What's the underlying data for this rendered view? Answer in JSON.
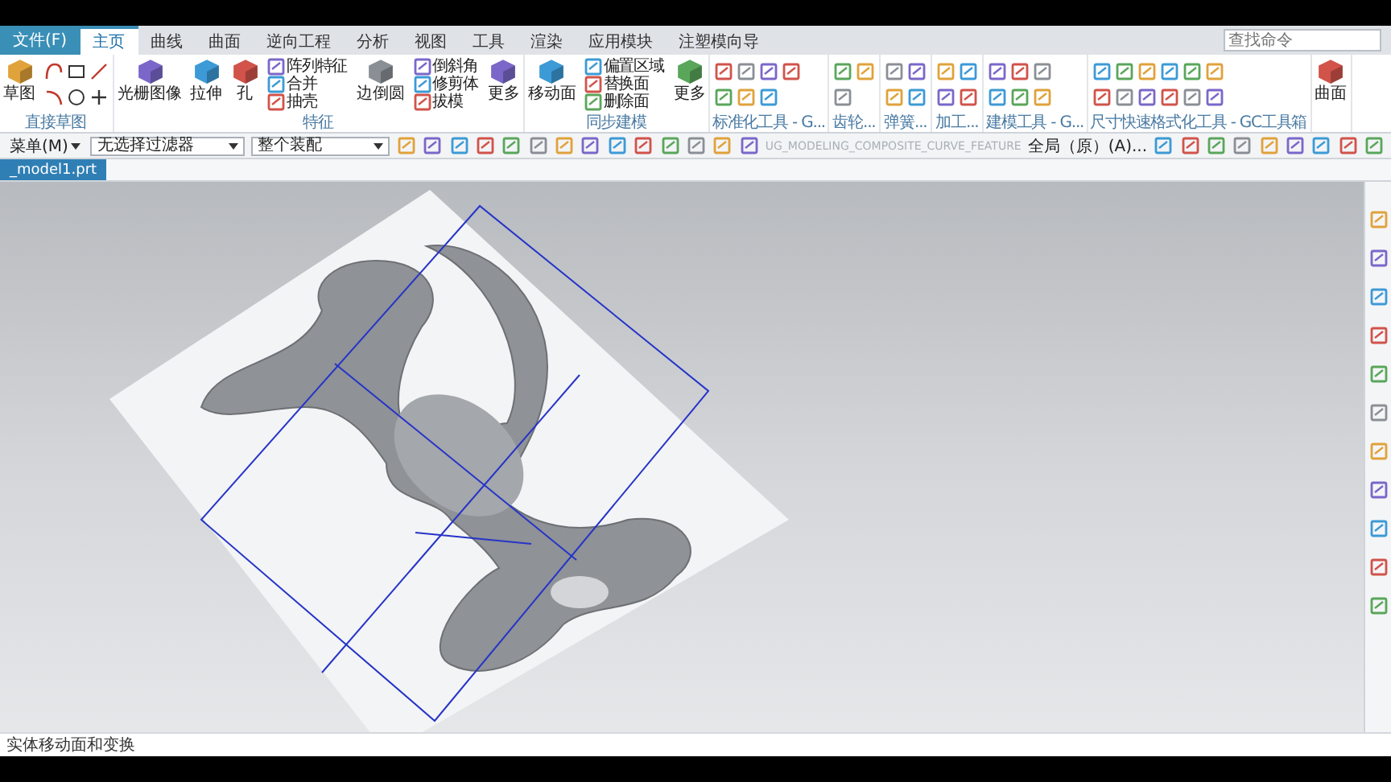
{
  "file_menu": {
    "label": "文件(F)"
  },
  "menu_tabs": [
    {
      "label": "主页",
      "kind": "tab",
      "selected": true
    },
    {
      "label": "曲线",
      "kind": "tab",
      "selected": false
    },
    {
      "label": "曲面",
      "kind": "tab",
      "selected": false
    },
    {
      "label": "逆向工程",
      "kind": "tab",
      "selected": false
    },
    {
      "label": "分析",
      "kind": "tab",
      "selected": false
    },
    {
      "label": "视图",
      "kind": "tab",
      "selected": false
    },
    {
      "label": "工具",
      "kind": "tab",
      "selected": false
    },
    {
      "label": "渲染",
      "kind": "tab",
      "selected": false
    },
    {
      "label": "应用模块",
      "kind": "tab",
      "selected": false
    },
    {
      "label": "注塑模向导",
      "kind": "tab",
      "selected": false
    }
  ],
  "search": {
    "placeholder": "查找命令"
  },
  "ribbon_groups": [
    {
      "label": "直接草图",
      "items": [
        {
          "kind": "large",
          "label": "草图"
        },
        {
          "kind": "sketch_tools"
        }
      ]
    },
    {
      "label": "特征",
      "items": [
        {
          "kind": "large",
          "label": "光栅图像"
        },
        {
          "kind": "large",
          "label": "拉伸"
        },
        {
          "kind": "large",
          "label": "孔"
        },
        {
          "kind": "column",
          "labels": [
            "阵列特征",
            "合并",
            "抽壳"
          ]
        },
        {
          "kind": "large",
          "label": "边倒圆"
        },
        {
          "kind": "column",
          "labels": [
            "倒斜角",
            "修剪体",
            "拔模"
          ]
        },
        {
          "kind": "large",
          "label": "更多"
        }
      ]
    },
    {
      "label": "同步建模",
      "items": [
        {
          "kind": "large",
          "label": "移动面"
        },
        {
          "kind": "column",
          "labels": [
            "偏置区域",
            "替换面",
            "删除面"
          ]
        },
        {
          "kind": "large",
          "label": "更多"
        }
      ]
    },
    {
      "label": "标准化工具 - G...",
      "items": [
        {
          "kind": "icons"
        }
      ]
    },
    {
      "label": "齿轮...",
      "items": [
        {
          "kind": "icons"
        }
      ]
    },
    {
      "label": "弹簧...",
      "items": [
        {
          "kind": "icons"
        }
      ]
    },
    {
      "label": "加工...",
      "items": [
        {
          "kind": "icons"
        }
      ]
    },
    {
      "label": "建模工具 - G...",
      "items": [
        {
          "kind": "icons"
        }
      ]
    },
    {
      "label": "尺寸快速格式化工具 - GC工具箱",
      "items": [
        {
          "kind": "icons"
        }
      ]
    },
    {
      "items": [
        {
          "kind": "large",
          "label": "曲面"
        }
      ]
    }
  ],
  "toolbar": {
    "menu": "菜单(M)",
    "filter": "无选择过滤器",
    "scope": "整个装配",
    "command_hint": "UG_MODELING_COMPOSITE_CURVE_FEATURE",
    "snap": "全局（原）(A)..."
  },
  "document_tabs": [
    {
      "label": "_model1.prt",
      "selected": true
    }
  ],
  "status_bar": {
    "text": "实体移动面和变换"
  }
}
